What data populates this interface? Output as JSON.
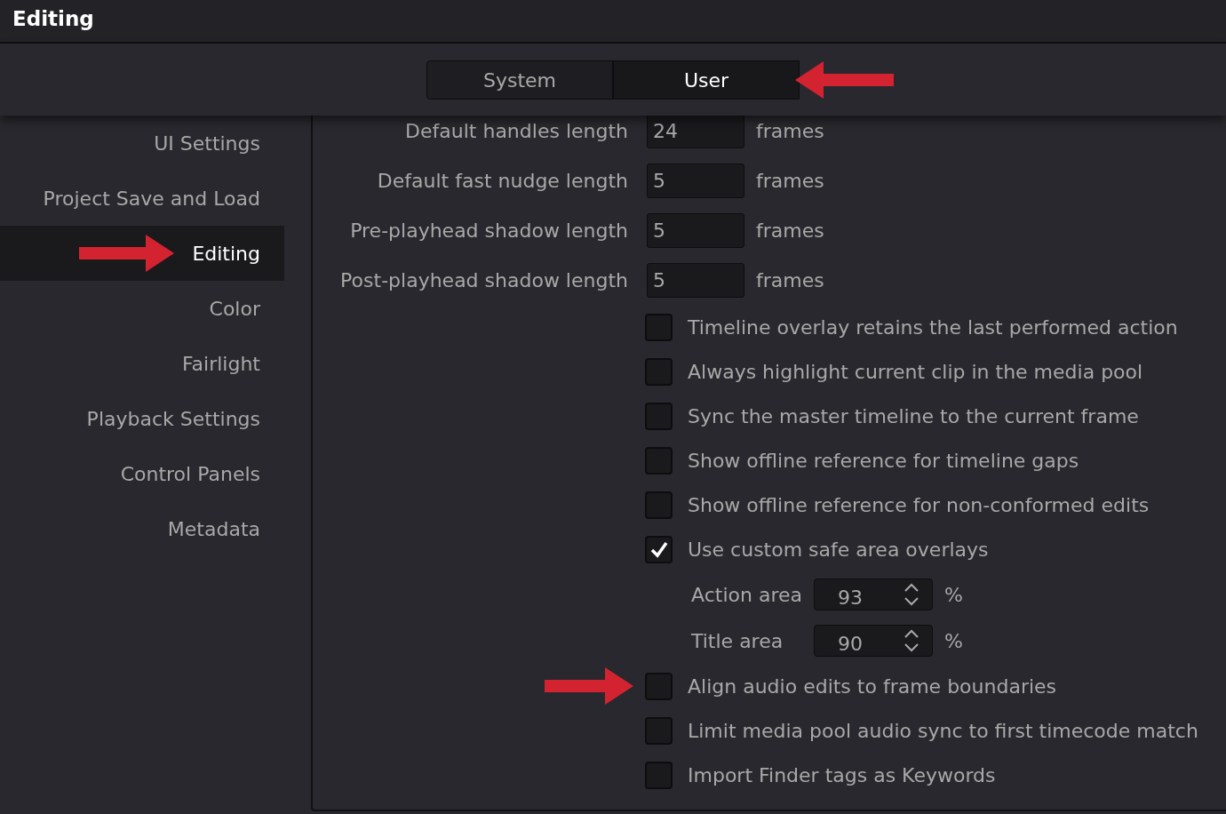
{
  "window": {
    "title": "Editing"
  },
  "tabs": [
    {
      "label": "System",
      "selected": false,
      "marked": false
    },
    {
      "label": "User",
      "selected": true,
      "marked": true
    }
  ],
  "sidebar": {
    "items": [
      {
        "label": "UI Settings",
        "selected": false,
        "marked": false
      },
      {
        "label": "Project Save and Load",
        "selected": false,
        "marked": false
      },
      {
        "label": "Editing",
        "selected": true,
        "marked": true
      },
      {
        "label": "Color",
        "selected": false,
        "marked": false
      },
      {
        "label": "Fairlight",
        "selected": false,
        "marked": false
      },
      {
        "label": "Playback Settings",
        "selected": false,
        "marked": false
      },
      {
        "label": "Control Panels",
        "selected": false,
        "marked": false
      },
      {
        "label": "Metadata",
        "selected": false,
        "marked": false
      }
    ]
  },
  "settings": [
    {
      "kind": "number",
      "label": "Default handles length",
      "value": "24",
      "unit": "frames"
    },
    {
      "kind": "number",
      "label": "Default fast nudge length",
      "value": "5",
      "unit": "frames"
    },
    {
      "kind": "number",
      "label": "Pre-playhead shadow length",
      "value": "5",
      "unit": "frames"
    },
    {
      "kind": "number",
      "label": "Post-playhead shadow length",
      "value": "5",
      "unit": "frames"
    },
    {
      "kind": "checkbox",
      "label": "Timeline overlay retains the last performed action",
      "checked": false,
      "marked": false
    },
    {
      "kind": "checkbox",
      "label": "Always highlight current clip in the media pool",
      "checked": false,
      "marked": false
    },
    {
      "kind": "checkbox",
      "label": "Sync the master timeline to the current frame",
      "checked": false,
      "marked": false
    },
    {
      "kind": "checkbox",
      "label": "Show offline reference for timeline gaps",
      "checked": false,
      "marked": false
    },
    {
      "kind": "checkbox",
      "label": "Show offline reference for non-conformed edits",
      "checked": false,
      "marked": false
    },
    {
      "kind": "checkbox",
      "label": "Use custom safe area overlays",
      "checked": true,
      "marked": false
    },
    {
      "kind": "spin",
      "label": "Action area",
      "value": "93",
      "unit": "%"
    },
    {
      "kind": "spin",
      "label": "Title area",
      "value": "90",
      "unit": "%"
    },
    {
      "kind": "checkbox",
      "label": "Align audio edits to frame boundaries",
      "checked": false,
      "marked": true
    },
    {
      "kind": "checkbox",
      "label": "Limit media pool audio sync to first timecode match",
      "checked": false,
      "marked": false
    },
    {
      "kind": "checkbox",
      "label": "Import Finder tags as Keywords",
      "checked": false,
      "marked": false
    }
  ]
}
